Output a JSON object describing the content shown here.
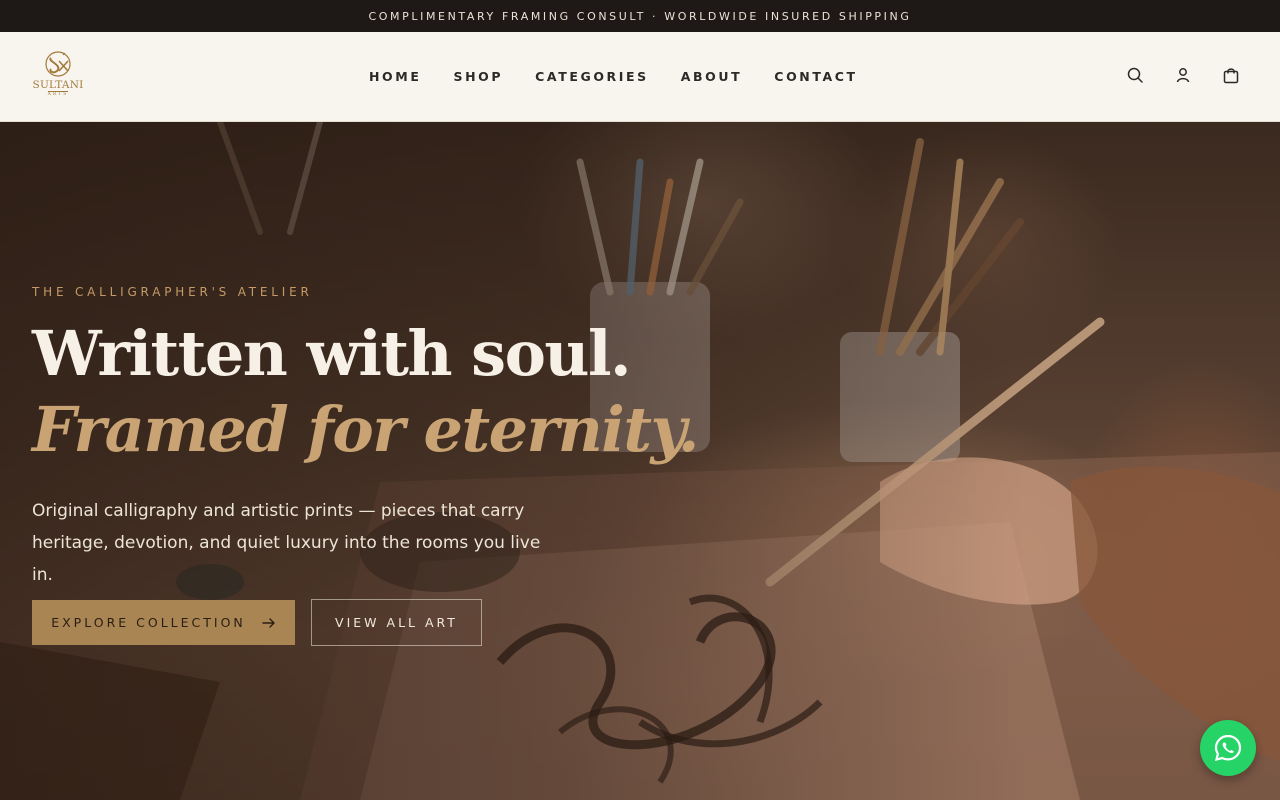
{
  "announcement": "COMPLIMENTARY FRAMING CONSULT · WORLDWIDE INSURED SHIPPING",
  "logo": {
    "name": "SULTANI",
    "sub": "ARTS"
  },
  "nav": {
    "items": [
      "HOME",
      "SHOP",
      "CATEGORIES",
      "ABOUT",
      "CONTACT"
    ]
  },
  "header_icons": [
    "search-icon",
    "user-icon",
    "shopping-bag-icon"
  ],
  "hero": {
    "eyebrow": "THE CALLIGRAPHER'S ATELIER",
    "headline": "Written with soul.",
    "headline_accent": "Framed for eternity.",
    "lede": "Original calligraphy and artistic prints — pieces that carry heritage, devotion, and quiet luxury into the rooms you live in.",
    "cta_primary": "EXPLORE COLLECTION",
    "cta_secondary": "VIEW ALL ART"
  },
  "chat_button": "whatsapp-icon",
  "colors": {
    "topbar": "#1e1916",
    "header": "#f8f5ef",
    "accent_gold": "#a98554",
    "headline_accent": "#c9a373",
    "whatsapp": "#25d366"
  }
}
